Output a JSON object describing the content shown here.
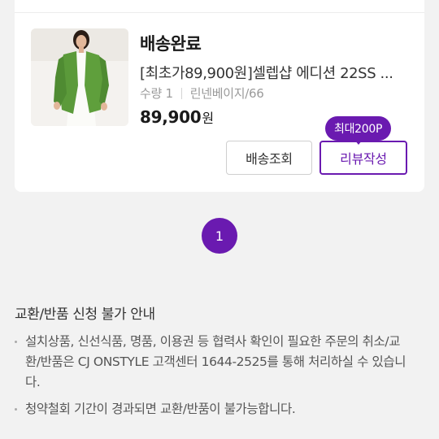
{
  "order": {
    "status": "배송완료",
    "product_title": "[최초가89,900원]셀렙샵 에디션 22SS ...",
    "quantity": "수량 1",
    "option": "린넨베이지/66",
    "price": "89,900",
    "price_unit": "원",
    "track_button": "배송조회",
    "review_button": "리뷰작성",
    "review_badge": "최대200P"
  },
  "pagination": {
    "current": "1"
  },
  "notice": {
    "title": "교환/반품 신청 불가 안내",
    "items": [
      "설치상품, 신선식품, 명품, 이용권 등 협력사 확인이 필요한 주문의 취소/교환/반품은 CJ ONSTYLE 고객센터 1644-2525를 통해 처리하실 수 있습니다.",
      "청약철회 기간이 경과되면 교환/반품이 불가능합니다."
    ]
  },
  "colors": {
    "accent": "#6a1ab0",
    "background": "#f2f2f2",
    "card": "#ffffff"
  }
}
